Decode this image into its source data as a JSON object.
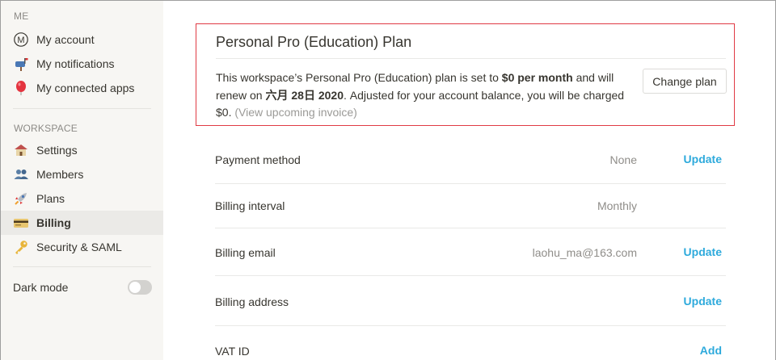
{
  "sidebar": {
    "me_label": "ME",
    "me_items": [
      {
        "label": "My account",
        "icon": "account-circle-icon"
      },
      {
        "label": "My notifications",
        "icon": "mailbox-icon"
      },
      {
        "label": "My connected apps",
        "icon": "balloon-icon"
      }
    ],
    "workspace_label": "WORKSPACE",
    "workspace_items": [
      {
        "label": "Settings",
        "icon": "house-icon"
      },
      {
        "label": "Members",
        "icon": "people-icon"
      },
      {
        "label": "Plans",
        "icon": "rocket-icon"
      },
      {
        "label": "Billing",
        "icon": "credit-card-icon",
        "active": true
      },
      {
        "label": "Security & SAML",
        "icon": "key-icon"
      }
    ],
    "dark_mode_label": "Dark mode",
    "dark_mode_on": false
  },
  "plan": {
    "title": "Personal Pro (Education) Plan",
    "desc_1": "This workspace’s Personal Pro (Education) plan is set to ",
    "price": "$0 per month",
    "desc_2": " and will renew on ",
    "renew_date": "六月 28日 2020",
    "desc_3": ". Adjusted for your account balance, you will be charged $0.",
    "invoice_link": "(View upcoming invoice)",
    "change_button": "Change plan"
  },
  "billing_rows": [
    {
      "label": "Payment method",
      "value": "None",
      "action": "Update"
    },
    {
      "label": "Billing interval",
      "value": "Monthly",
      "action": ""
    },
    {
      "label": "Billing email",
      "value": "laohu_ma@163.com",
      "action": "Update"
    },
    {
      "label": "Billing address",
      "value": "",
      "action": "Update"
    },
    {
      "label": "VAT ID",
      "value": "",
      "action": "Add"
    }
  ],
  "colors": {
    "accent_link": "#2eaadc",
    "highlight_border": "#e03a44",
    "sidebar_bg": "#f7f6f3"
  }
}
